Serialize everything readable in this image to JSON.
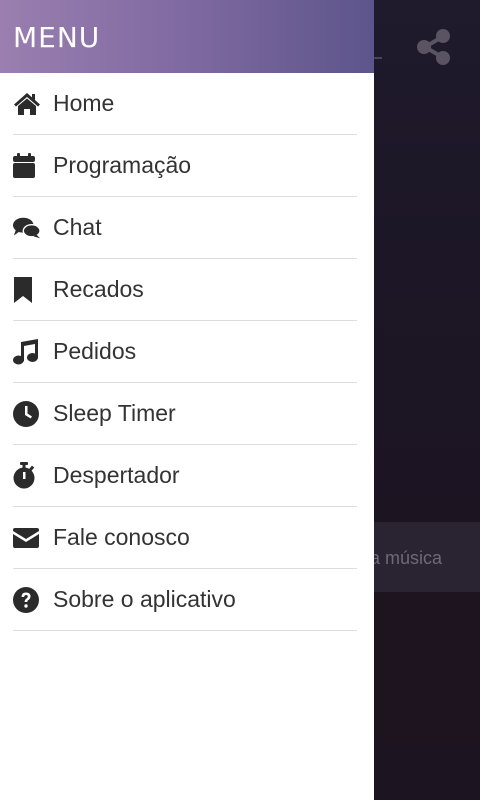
{
  "background": {
    "song_text": "a música"
  },
  "drawer": {
    "title": "MENU",
    "items": [
      {
        "label": "Home",
        "icon": "home-icon"
      },
      {
        "label": "Programação",
        "icon": "calendar-icon"
      },
      {
        "label": "Chat",
        "icon": "chat-icon"
      },
      {
        "label": "Recados",
        "icon": "bookmark-icon"
      },
      {
        "label": "Pedidos",
        "icon": "music-note-icon"
      },
      {
        "label": "Sleep Timer",
        "icon": "clock-icon"
      },
      {
        "label": "Despertador",
        "icon": "stopwatch-icon"
      },
      {
        "label": "Fale conosco",
        "icon": "envelope-icon"
      },
      {
        "label": "Sobre o aplicativo",
        "icon": "question-circle-icon"
      }
    ]
  },
  "colors": {
    "header_gradient_start": "#9a7fb0",
    "header_gradient_end": "#5c558b",
    "icon_color": "#2b2b2b",
    "text_color": "#333333",
    "divider_color": "#dddddd"
  }
}
